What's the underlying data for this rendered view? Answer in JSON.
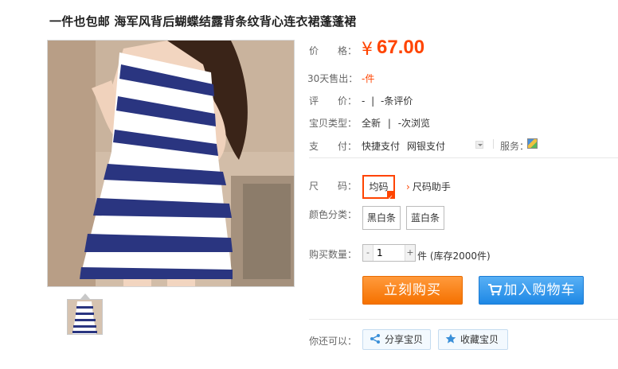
{
  "title": "一件也包邮 海军风背后蝴蝶结露背条纹背心连衣裙蓬蓬裙",
  "price": {
    "label": "价　　格：",
    "currency": "¥",
    "value": "67.00"
  },
  "sales": {
    "label": "30天售出：",
    "value": "-件"
  },
  "review": {
    "label": "评　　价：",
    "value": "-",
    "sep": "|",
    "count": "-条评价"
  },
  "item_type": {
    "label": "宝贝类型：",
    "condition": "全新",
    "sep": "|",
    "views": "-次浏览"
  },
  "payment": {
    "label": "支　　付：",
    "method1": "快捷支付",
    "method2": "网银支付",
    "service_label": "服务："
  },
  "size": {
    "label": "尺　　码：",
    "option": "均码",
    "help": "尺码助手"
  },
  "color": {
    "label": "颜色分类：",
    "options": [
      "黑白条",
      "蓝白条"
    ]
  },
  "quantity": {
    "label": "购买数量：",
    "value": "1",
    "minus": "-",
    "plus": "+",
    "unit": "件 (库存2000件)"
  },
  "buttons": {
    "buy": "立刻购买",
    "cart": "加入购物车"
  },
  "share": {
    "label": "你还可以：",
    "share": "分享宝贝",
    "favorite": "收藏宝贝"
  },
  "colors": {
    "accent": "#ff4400",
    "buy": "#f57100",
    "cart": "#1e88e5"
  },
  "icons": {
    "cart": "shopping-cart-icon",
    "share": "share-icon",
    "fav": "star-icon",
    "service": "service-icon"
  }
}
